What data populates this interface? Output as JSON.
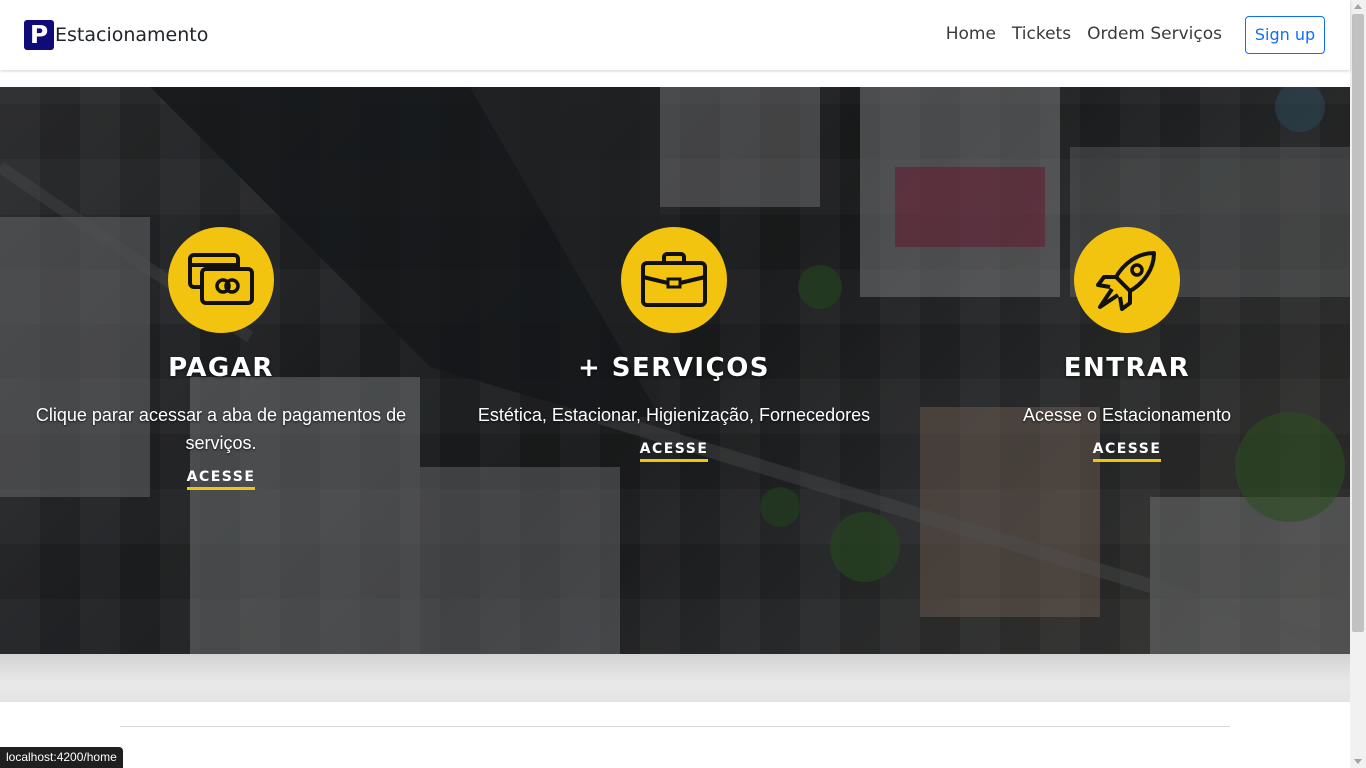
{
  "navbar": {
    "brand_logo_letter": "P",
    "brand_name": "Estacionamento",
    "links": [
      "Home",
      "Tickets",
      "Ordem Serviços"
    ],
    "signup_label": "Sign up"
  },
  "hero": {
    "features": [
      {
        "icon": "credit-cards-icon",
        "title": "PAGAR",
        "description": "Clique parar acessar a aba de pagamentos de serviços.",
        "link_label": "ACESSE"
      },
      {
        "icon": "briefcase-icon",
        "title": "+ SERVIÇOS",
        "description": "Estética, Estacionar, Higienização, Fornecedores",
        "link_label": "ACESSE"
      },
      {
        "icon": "rocket-icon",
        "title": "ENTRAR",
        "description": "Acesse o Estacionamento",
        "link_label": "ACESSE"
      }
    ]
  },
  "status_bar": {
    "url": "localhost:4200/home"
  },
  "colors": {
    "accent_yellow": "#f2c40f",
    "brand_navy": "#0f0c7a",
    "button_blue": "#0d6efd"
  }
}
